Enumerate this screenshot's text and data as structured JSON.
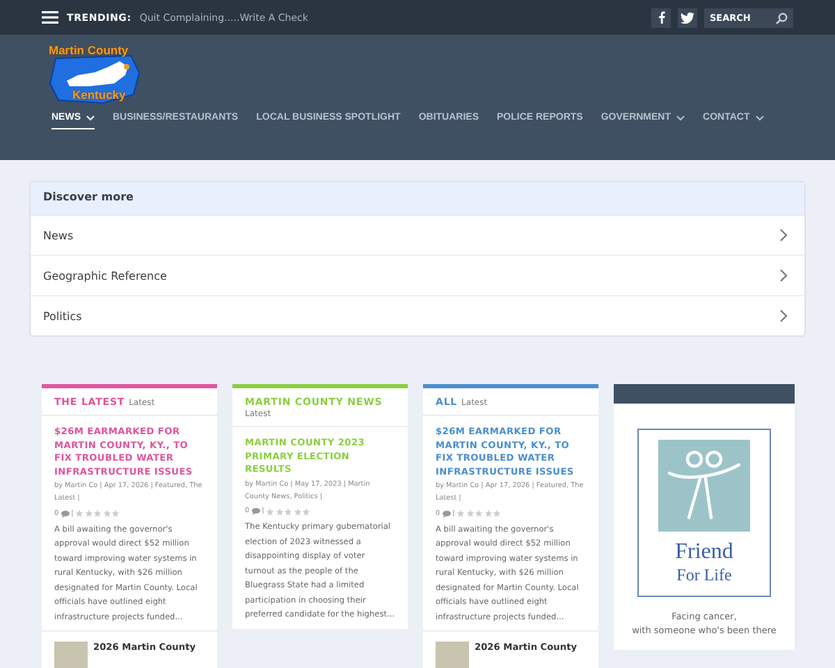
{
  "top_bar": {
    "trending_label": "TRENDING:",
    "trending_text": "Quit Complaining.....Write A Check",
    "search": {
      "placeholder": "SEARCH"
    }
  },
  "logo": {
    "line_1": "Martin County",
    "line_2": "Kentucky"
  },
  "nav": [
    {
      "label": "NEWS",
      "selected": true,
      "has_menu": true
    },
    {
      "label": "BUSINESS/RESTAURANTS",
      "selected": false,
      "has_menu": false
    },
    {
      "label": "LOCAL BUSINESS SPOTLIGHT",
      "selected": false,
      "has_menu": false
    },
    {
      "label": "OBITUARIES",
      "selected": false,
      "has_menu": false
    },
    {
      "label": "POLICE REPORTS",
      "selected": false,
      "has_menu": false
    },
    {
      "label": "GOVERNMENT",
      "selected": false,
      "has_menu": true
    },
    {
      "label": "CONTACT",
      "selected": false,
      "has_menu": true
    }
  ],
  "discover": {
    "title": "Discover more",
    "items": [
      "News",
      "Geographic Reference",
      "Politics"
    ]
  },
  "cards": [
    {
      "heading": "THE LATEST",
      "sub": "Latest",
      "color": "#e0559d",
      "title": "$26M EARMARKED FOR MARTIN COUNTY, KY., TO FIX TROUBLED WATER INFRASTRUCTURE ISSUES",
      "meta": "by Martin Co | Apr 17, 2026 | Featured, The Latest |",
      "comments": "0",
      "after": "|",
      "stars": 0,
      "excerpt": "A bill awaiting the governor's approval would direct $52 million toward improving water systems in rural Kentucky, with $26 million designated for Martin County. Local officials have outlined eight infrastructure projects funded...",
      "footer_title": "2026 Martin County"
    },
    {
      "heading": "MARTIN COUNTY NEWS",
      "sub": "Latest",
      "color": "#8ccf3f",
      "title": "MARTIN COUNTY 2023 PRIMARY ELECTION RESULTS",
      "meta": "by Martin Co | May 17, 2023 | Martin County News, Politics |",
      "comments": "0",
      "after": "|",
      "stars": 0,
      "excerpt": "The Kentucky primary gubernatorial election of 2023 witnessed a disappointing display of voter turnout as the people of the Bluegrass State had a limited participation in choosing their preferred candidate for the highest..."
    },
    {
      "heading": "ALL",
      "sub": "Latest",
      "color": "#4a8fd0",
      "title": "$26M EARMARKED FOR MARTIN COUNTY, KY., TO FIX TROUBLED WATER INFRASTRUCTURE ISSUES",
      "meta": "by Martin Co | Apr 17, 2026 | Featured, The Latest |",
      "comments": "0",
      "after": "|",
      "stars": 0,
      "excerpt": "A bill awaiting the governor's approval would direct $52 million toward improving water systems in rural Kentucky, with $26 million designated for Martin County. Local officials have outlined eight infrastructure projects funded...",
      "footer_title": "2026 Martin County"
    }
  ],
  "ad": {
    "logo_line_1": "Friend",
    "logo_line_2": "For Life",
    "caption_1": "Facing cancer,",
    "caption_2": "with someone who's been there"
  }
}
